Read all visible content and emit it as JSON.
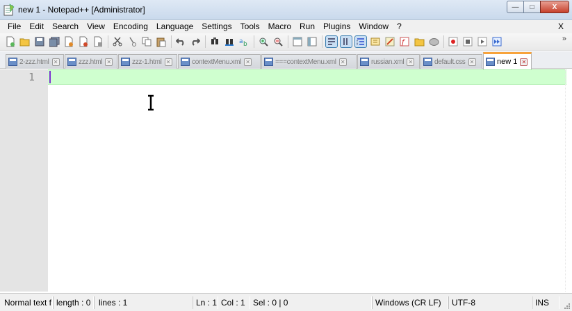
{
  "window": {
    "title": "new 1 - Notepad++ [Administrator]",
    "minimize_glyph": "—",
    "maximize_glyph": "□",
    "close_glyph": "X"
  },
  "menu": {
    "items": [
      "File",
      "Edit",
      "Search",
      "View",
      "Encoding",
      "Language",
      "Settings",
      "Tools",
      "Macro",
      "Run",
      "Plugins",
      "Window",
      "?"
    ],
    "close_label": "X"
  },
  "toolbar": {
    "buttons": [
      {
        "icon": "new-file-icon"
      },
      {
        "icon": "open-file-icon"
      },
      {
        "icon": "save-icon"
      },
      {
        "icon": "save-all-icon"
      },
      {
        "icon": "close-icon"
      },
      {
        "icon": "close-all-icon"
      },
      {
        "icon": "print-icon"
      },
      {
        "icon": "cut-icon"
      },
      {
        "icon": "copy-icon"
      },
      {
        "icon": "paste-icon"
      },
      {
        "icon": "clipboard-icon"
      },
      {
        "icon": "undo-icon"
      },
      {
        "icon": "redo-icon"
      },
      {
        "icon": "find-icon"
      },
      {
        "icon": "replace-icon"
      },
      {
        "icon": "find-in-files-icon"
      },
      {
        "icon": "zoom-in-icon"
      },
      {
        "icon": "zoom-out-icon"
      },
      {
        "icon": "sync-vertical-icon"
      },
      {
        "icon": "sync-horizontal-icon"
      },
      {
        "icon": "word-wrap-icon"
      },
      {
        "icon": "show-all-chars-icon"
      },
      {
        "icon": "indent-guide-icon"
      },
      {
        "icon": "user-lang-icon"
      },
      {
        "icon": "doc-map-icon"
      },
      {
        "icon": "function-list-icon"
      },
      {
        "icon": "folder-workspace-icon"
      },
      {
        "icon": "monitoring-icon"
      },
      {
        "icon": "record-macro-icon"
      },
      {
        "icon": "stop-macro-icon"
      },
      {
        "icon": "play-macro-icon"
      },
      {
        "icon": "run-macro-multiple-icon"
      }
    ],
    "overflow_glyph": "»"
  },
  "tabs": [
    {
      "label": "2-zzz.html",
      "active": false
    },
    {
      "label": "zzz.html",
      "active": false
    },
    {
      "label": "zzz-1.html",
      "active": false
    },
    {
      "label": "contextMenu.xml",
      "active": false
    },
    {
      "label": "===contextMenu.xml",
      "active": false
    },
    {
      "label": "russian.xml",
      "active": false
    },
    {
      "label": "default.css",
      "active": false
    },
    {
      "label": "new 1",
      "active": true
    }
  ],
  "editor": {
    "line_numbers": [
      "1"
    ],
    "content": "",
    "current_line_color": "#cfffcf",
    "caret_color": "#7a2fd0"
  },
  "status": {
    "doc_type": "Normal text f",
    "length": "length : 0",
    "lines": "lines : 1",
    "ln": "Ln : 1",
    "col": "Col : 1",
    "sel": "Sel : 0 | 0",
    "eol": "Windows (CR LF)",
    "encoding": "UTF-8",
    "mode": "INS"
  },
  "colors": {
    "active_tab_accent": "#f7a33c",
    "gutter": "#e4e4e4"
  }
}
